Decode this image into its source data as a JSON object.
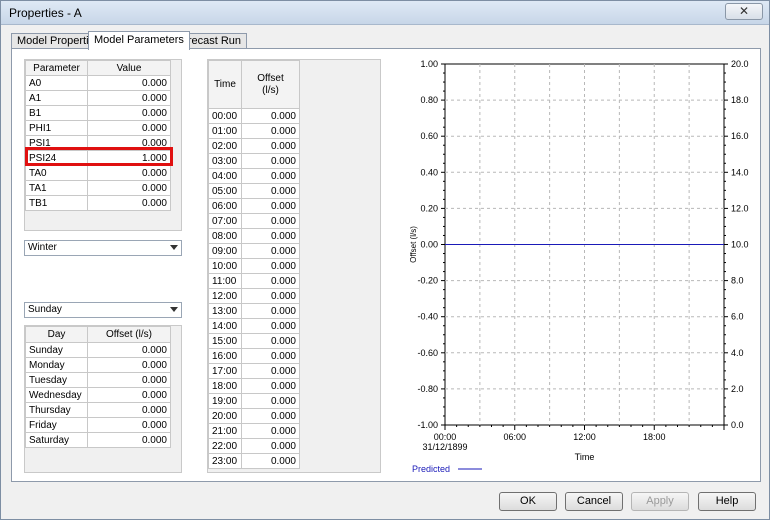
{
  "window": {
    "title": "Properties - A",
    "close_glyph": "✕"
  },
  "tabs": [
    {
      "label": "Model Properties"
    },
    {
      "label": "Model Parameters"
    },
    {
      "label": "Forecast Run"
    }
  ],
  "params_table": {
    "headers": [
      "Parameter",
      "Value"
    ],
    "rows": [
      {
        "name": "A0",
        "value": "0.000"
      },
      {
        "name": "A1",
        "value": "0.000"
      },
      {
        "name": "B1",
        "value": "0.000"
      },
      {
        "name": "PHI1",
        "value": "0.000"
      },
      {
        "name": "PSI1",
        "value": "0.000"
      },
      {
        "name": "PSI24",
        "value": "1.000"
      },
      {
        "name": "TA0",
        "value": "0.000"
      },
      {
        "name": "TA1",
        "value": "0.000"
      },
      {
        "name": "TB1",
        "value": "0.000"
      }
    ]
  },
  "season_select": {
    "value": "Winter"
  },
  "day_select": {
    "value": "Sunday"
  },
  "day_table": {
    "headers": [
      "Day",
      "Offset (l/s)"
    ],
    "rows": [
      {
        "day": "Sunday",
        "offset": "0.000"
      },
      {
        "day": "Monday",
        "offset": "0.000"
      },
      {
        "day": "Tuesday",
        "offset": "0.000"
      },
      {
        "day": "Wednesday",
        "offset": "0.000"
      },
      {
        "day": "Thursday",
        "offset": "0.000"
      },
      {
        "day": "Friday",
        "offset": "0.000"
      },
      {
        "day": "Saturday",
        "offset": "0.000"
      }
    ]
  },
  "time_table": {
    "headers": [
      "Time",
      "Offset\n(l/s)"
    ],
    "rows": [
      {
        "time": "00:00",
        "offset": "0.000"
      },
      {
        "time": "01:00",
        "offset": "0.000"
      },
      {
        "time": "02:00",
        "offset": "0.000"
      },
      {
        "time": "03:00",
        "offset": "0.000"
      },
      {
        "time": "04:00",
        "offset": "0.000"
      },
      {
        "time": "05:00",
        "offset": "0.000"
      },
      {
        "time": "06:00",
        "offset": "0.000"
      },
      {
        "time": "07:00",
        "offset": "0.000"
      },
      {
        "time": "08:00",
        "offset": "0.000"
      },
      {
        "time": "09:00",
        "offset": "0.000"
      },
      {
        "time": "10:00",
        "offset": "0.000"
      },
      {
        "time": "11:00",
        "offset": "0.000"
      },
      {
        "time": "12:00",
        "offset": "0.000"
      },
      {
        "time": "13:00",
        "offset": "0.000"
      },
      {
        "time": "14:00",
        "offset": "0.000"
      },
      {
        "time": "15:00",
        "offset": "0.000"
      },
      {
        "time": "16:00",
        "offset": "0.000"
      },
      {
        "time": "17:00",
        "offset": "0.000"
      },
      {
        "time": "18:00",
        "offset": "0.000"
      },
      {
        "time": "19:00",
        "offset": "0.000"
      },
      {
        "time": "20:00",
        "offset": "0.000"
      },
      {
        "time": "21:00",
        "offset": "0.000"
      },
      {
        "time": "22:00",
        "offset": "0.000"
      },
      {
        "time": "23:00",
        "offset": "0.000"
      }
    ]
  },
  "chart_data": {
    "type": "line",
    "xlabel": "Time",
    "ylabel": "Offset (l/s)",
    "x_ticks": [
      "00:00",
      "06:00",
      "12:00",
      "18:00"
    ],
    "x_first_date": "31/12/1899",
    "y_left_ticks": [
      "1.00",
      "0.80",
      "0.60",
      "0.40",
      "0.20",
      "0.00",
      "-0.20",
      "-0.40",
      "-0.60",
      "-0.80",
      "-1.00"
    ],
    "y_right_ticks": [
      "20.0",
      "18.0",
      "16.0",
      "14.0",
      "12.0",
      "10.0",
      "8.0",
      "6.0",
      "4.0",
      "2.0",
      "0.0"
    ],
    "ylim": [
      -1.0,
      1.0
    ],
    "y2lim": [
      0.0,
      20.0
    ],
    "grid": true,
    "legend_position": "bottom-left",
    "series": [
      {
        "name": "Predicted",
        "color": "#1a1ab8",
        "x_hours": [
          0,
          24
        ],
        "values": [
          0.0,
          0.0
        ]
      }
    ]
  },
  "buttons": {
    "ok": "OK",
    "cancel": "Cancel",
    "apply": "Apply",
    "help": "Help"
  }
}
